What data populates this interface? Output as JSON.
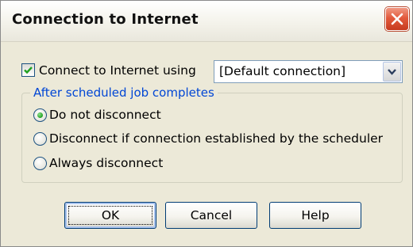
{
  "window": {
    "title": "Connection to Internet"
  },
  "connect": {
    "checkbox_label": "Connect to Internet using",
    "checked": true,
    "selected_connection": "[Default connection]"
  },
  "after_job": {
    "group_label": "After scheduled job completes",
    "options": [
      {
        "label": "Do not disconnect",
        "selected": true
      },
      {
        "label": "Disconnect if connection established by the scheduler",
        "selected": false
      },
      {
        "label": "Always disconnect",
        "selected": false
      }
    ]
  },
  "buttons": {
    "ok": "OK",
    "cancel": "Cancel",
    "help": "Help"
  },
  "icons": {
    "close": "close-icon",
    "check": "checkmark-icon",
    "dropdown": "chevron-down-icon"
  },
  "colors": {
    "window_bg": "#ece9d8",
    "close_button": "#e35a3c",
    "group_label": "#0046d5",
    "radio_selected": "#21a121"
  }
}
